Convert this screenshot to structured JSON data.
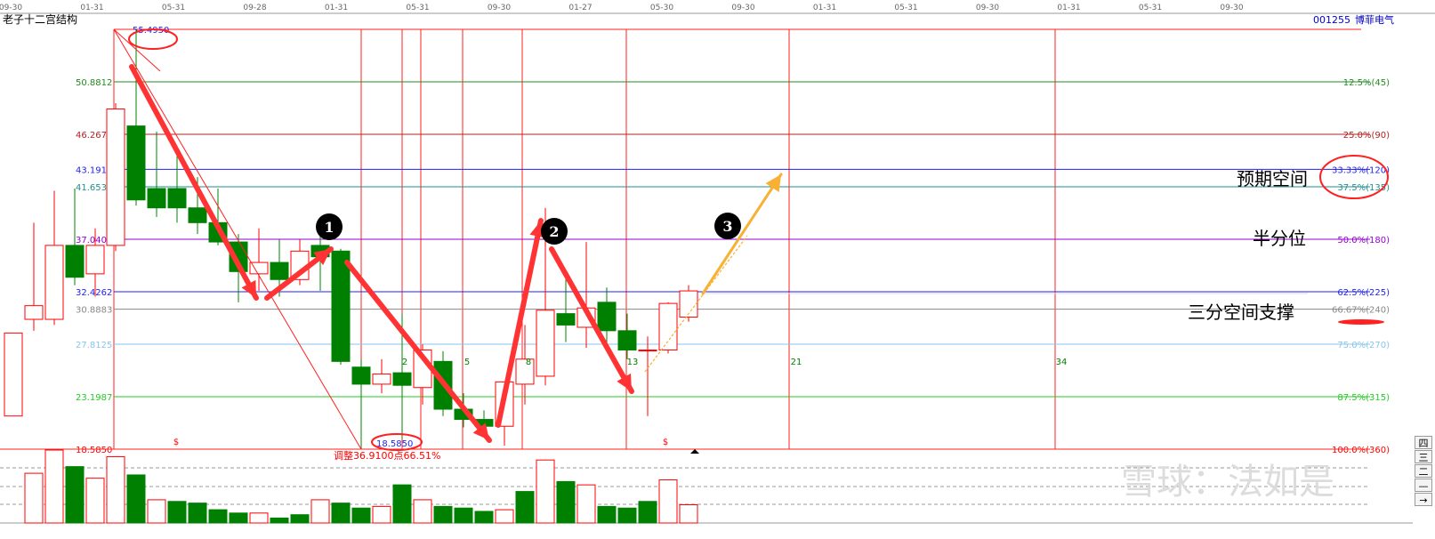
{
  "window": {
    "title": "老子十二宫结构",
    "stock_code": "001255",
    "stock_name": "博菲电气"
  },
  "top_axis_dates": [
    "09-30",
    "01-31",
    "05-31",
    "09-28",
    "01-31",
    "05-31",
    "09-30",
    "01-27",
    "05-30",
    "09-30",
    "01-31",
    "05-31",
    "09-30",
    "01-31",
    "05-31",
    "09-30"
  ],
  "side_buttons": [
    "四",
    "三",
    "二",
    "—",
    "→"
  ],
  "watermark": "雪球：法如是",
  "colors": {
    "up": "#ff0000",
    "down": "#008000",
    "bg": "#ffffff",
    "annotation": "#ff3333",
    "projection": "#f8b133"
  },
  "chart_data": {
    "type": "candlestick",
    "title": "老子十二宫结构",
    "ylim": [
      18.5,
      57.2
    ],
    "candles": [
      {
        "o": 21.5,
        "h": 28.8,
        "l": 21.5,
        "c": 28.8
      },
      {
        "o": 30.0,
        "h": 38.5,
        "l": 29.0,
        "c": 31.2
      },
      {
        "o": 30.0,
        "h": 41.3,
        "l": 29.5,
        "c": 36.5
      },
      {
        "o": 36.5,
        "h": 41.5,
        "l": 33.0,
        "c": 33.7
      },
      {
        "o": 34.0,
        "h": 38.0,
        "l": 32.0,
        "c": 36.5
      },
      {
        "o": 36.5,
        "h": 49.0,
        "l": 36.0,
        "c": 48.5
      },
      {
        "o": 47.0,
        "h": 55.5,
        "l": 40.0,
        "c": 40.5
      },
      {
        "o": 41.5,
        "h": 46.5,
        "l": 39.0,
        "c": 39.8
      },
      {
        "o": 41.5,
        "h": 45.0,
        "l": 38.5,
        "c": 39.8
      },
      {
        "o": 39.8,
        "h": 42.5,
        "l": 37.5,
        "c": 38.5
      },
      {
        "o": 38.5,
        "h": 41.5,
        "l": 36.5,
        "c": 36.8
      },
      {
        "o": 36.8,
        "h": 37.5,
        "l": 31.5,
        "c": 34.2
      },
      {
        "o": 34.0,
        "h": 38.0,
        "l": 32.5,
        "c": 35.0
      },
      {
        "o": 35.0,
        "h": 37.0,
        "l": 32.0,
        "c": 33.5
      },
      {
        "o": 33.5,
        "h": 37.0,
        "l": 33.0,
        "c": 36.0
      },
      {
        "o": 36.5,
        "h": 37.5,
        "l": 32.5,
        "c": 35.5
      },
      {
        "o": 36.0,
        "h": 36.2,
        "l": 26.0,
        "c": 26.3
      },
      {
        "o": 25.8,
        "h": 26.5,
        "l": 18.6,
        "c": 24.3
      },
      {
        "o": 24.3,
        "h": 26.5,
        "l": 23.5,
        "c": 25.2
      },
      {
        "o": 25.3,
        "h": 30.5,
        "l": 19.5,
        "c": 24.2
      },
      {
        "o": 24.0,
        "h": 27.8,
        "l": 22.5,
        "c": 27.3
      },
      {
        "o": 26.3,
        "h": 27.2,
        "l": 21.5,
        "c": 22.1
      },
      {
        "o": 22.1,
        "h": 23.5,
        "l": 20.5,
        "c": 21.2
      },
      {
        "o": 21.2,
        "h": 22.0,
        "l": 20.5,
        "c": 20.6
      },
      {
        "o": 20.6,
        "h": 24.5,
        "l": 18.9,
        "c": 24.5
      },
      {
        "o": 24.3,
        "h": 29.5,
        "l": 22.5,
        "c": 26.5
      },
      {
        "o": 25.0,
        "h": 39.8,
        "l": 24.2,
        "c": 30.8
      },
      {
        "o": 30.5,
        "h": 33.5,
        "l": 28.0,
        "c": 29.5
      },
      {
        "o": 29.3,
        "h": 36.8,
        "l": 27.5,
        "c": 31.0
      },
      {
        "o": 31.5,
        "h": 32.8,
        "l": 28.0,
        "c": 29.0
      },
      {
        "o": 29.0,
        "h": 30.5,
        "l": 26.5,
        "c": 27.3
      },
      {
        "o": 27.3,
        "h": 28.5,
        "l": 21.5,
        "c": 27.3
      },
      {
        "o": 27.3,
        "h": 31.5,
        "l": 27.0,
        "c": 31.4
      },
      {
        "o": 30.2,
        "h": 33.0,
        "l": 29.8,
        "c": 32.5
      }
    ],
    "volumes": [
      0,
      30,
      44,
      34,
      27,
      40,
      29,
      14,
      13,
      12,
      8,
      6,
      6,
      3,
      5,
      14,
      12,
      9,
      10,
      23,
      14,
      10,
      9,
      7,
      8,
      19,
      38,
      25,
      23,
      10,
      9,
      13,
      26,
      11
    ],
    "volume_up_flags": [
      1,
      1,
      1,
      0,
      1,
      1,
      0,
      1,
      0,
      0,
      0,
      0,
      1,
      0,
      0,
      1,
      0,
      0,
      1,
      0,
      1,
      0,
      0,
      0,
      1,
      0,
      1,
      0,
      1,
      0,
      0,
      0,
      1,
      1
    ],
    "levels": [
      {
        "price": 55.495,
        "left_label": "55.4950",
        "right_label": "",
        "color": "#0000cc"
      },
      {
        "price": 50.8812,
        "left_label": "50.8812",
        "right_label": "12.5%(45)",
        "color": "#228b22"
      },
      {
        "price": 46.2675,
        "left_label": "46.2675",
        "right_label": "25.0%(90)",
        "color": "#b22222"
      },
      {
        "price": 43.1916,
        "left_label": "43.1916",
        "right_label": "33.33%(120)",
        "color": "#2222ee"
      },
      {
        "price": 41.6537,
        "left_label": "41.6537",
        "right_label": "37.5%(135)",
        "color": "#1f8f8f"
      },
      {
        "price": 37.04,
        "left_label": "37.0400",
        "right_label": "50.0%(180)",
        "color": "#9400d3"
      },
      {
        "price": 32.4262,
        "left_label": "32.4262",
        "right_label": "62.5%(225)",
        "color": "#2222ee"
      },
      {
        "price": 30.8883,
        "left_label": "30.8883",
        "right_label": "66.67%(240)",
        "color": "#888888"
      },
      {
        "price": 27.8125,
        "left_label": "27.8125",
        "right_label": "75.0%(270)",
        "color": "#87c6ec"
      },
      {
        "price": 23.1987,
        "left_label": "23.1987",
        "right_label": "87.5%(315)",
        "color": "#22cc22"
      },
      {
        "price": 18.585,
        "left_label": "18.5850",
        "right_label": "100.0%(360)",
        "color": "#ff0000"
      }
    ],
    "fib_day_labels": [
      "2",
      "5",
      "8",
      "13",
      "21",
      "34"
    ],
    "annotations": {
      "low_label": "18.5850",
      "adjust_text": "调整36.9100点66.51%",
      "dollar_mark": "$",
      "expected_space": "预期空间",
      "half_position": "半分位",
      "third_support": "三分空间支撑",
      "wave_1": "1",
      "wave_2": "2",
      "wave_3": "3"
    }
  }
}
